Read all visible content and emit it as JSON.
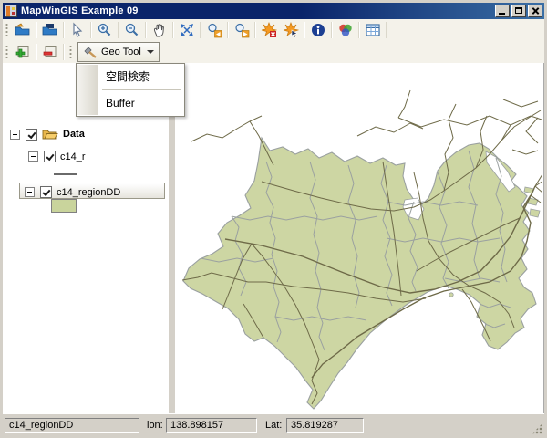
{
  "window": {
    "title": "MapWinGIS Example 09",
    "controls": [
      "minimize",
      "maximize",
      "close"
    ]
  },
  "toolbar_main": {
    "icons": [
      "open",
      "save",
      "cursor",
      "zoom-in",
      "zoom-out",
      "pan",
      "zoom-extent",
      "zoom-previous",
      "zoom-next",
      "clear-shapes",
      "select-shape",
      "info",
      "symbology",
      "attribute-table"
    ]
  },
  "toolbar_layers": {
    "icons": [
      "add-layer",
      "remove-layer"
    ],
    "geo_tool": {
      "label": "Geo Tool"
    }
  },
  "geo_tool_menu": {
    "items": [
      {
        "label": "空間検索"
      },
      {
        "label": "Buffer"
      }
    ]
  },
  "legend": {
    "root": {
      "label": "Data",
      "checked": true
    },
    "layers": [
      {
        "label": "c14_r",
        "checked": true,
        "symbol": "line"
      },
      {
        "label": "c14_regionDD",
        "checked": true,
        "symbol": "fill",
        "fill_color": "#c9d49c",
        "selected": true
      }
    ]
  },
  "statusbar": {
    "layer_name": "c14_regionDD",
    "lon_label": "lon:",
    "lon_value": "138.898157",
    "lat_label": "Lat:",
    "lat_value": "35.819287"
  },
  "map": {
    "background": "#ffffff",
    "region_fill": "#cdd6a3",
    "boundary_color": "#9aa0a0",
    "road_color": "#6e6a48"
  },
  "colors": {
    "titlebar": "#0a246a",
    "chrome": "#d4d0c8",
    "toolbar_bg": "#f4f2ea"
  }
}
